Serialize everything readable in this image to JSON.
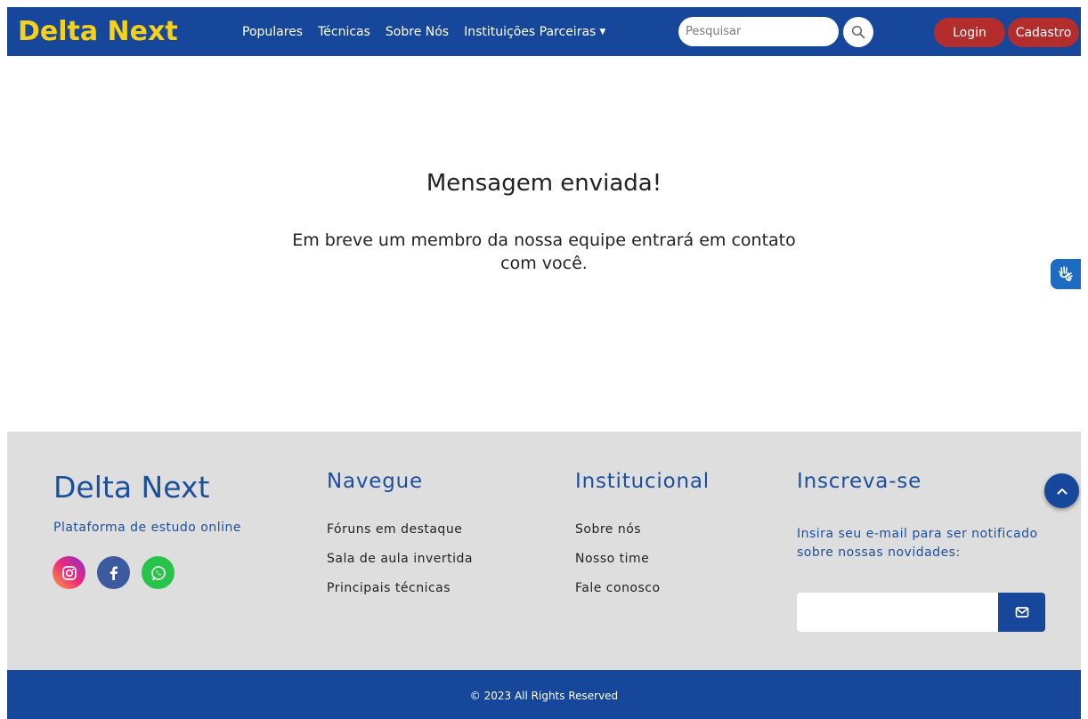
{
  "navbar": {
    "brand": "Delta Next",
    "links": [
      "Populares",
      "Técnicas",
      "Sobre Nós",
      "Instituições Parceiras"
    ],
    "search_placeholder": "Pesquisar",
    "login_label": "Login",
    "signup_label": "Cadastro"
  },
  "main": {
    "title": "Mensagem enviada!",
    "body": "Em breve um membro da nossa equipe entrará em contato com você."
  },
  "footer": {
    "brand": "Delta Next",
    "tagline": "Plataforma de estudo online",
    "social": [
      "instagram-icon",
      "facebook-icon",
      "whatsapp-icon"
    ],
    "navigate": {
      "heading": "Navegue",
      "links": [
        "Fóruns em destaque",
        "Sala de aula invertida",
        "Principais técnicas"
      ]
    },
    "institutional": {
      "heading": "Institucional",
      "links": [
        "Sobre nós",
        "Nosso time",
        "Fale conosco"
      ]
    },
    "subscribe": {
      "heading": "Inscreva-se",
      "text": "Insira seu e-mail para ser notificado sobre nossas novidades:",
      "email_placeholder": ""
    },
    "copyright": "© 2023 All Rights Reserved"
  },
  "colors": {
    "primary": "#16479a",
    "brand_yellow": "#f6d11c",
    "danger": "#b32d2d",
    "footer_bg": "#dedede"
  }
}
